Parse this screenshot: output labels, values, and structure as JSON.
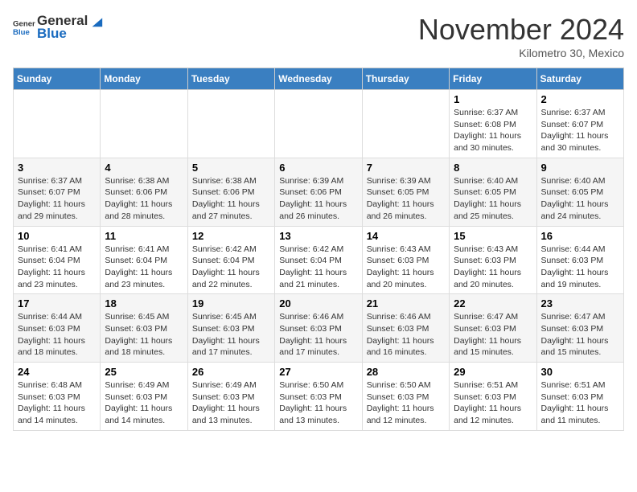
{
  "header": {
    "logo_general": "General",
    "logo_blue": "Blue",
    "month_title": "November 2024",
    "location": "Kilometro 30, Mexico"
  },
  "weekdays": [
    "Sunday",
    "Monday",
    "Tuesday",
    "Wednesday",
    "Thursday",
    "Friday",
    "Saturday"
  ],
  "weeks": [
    [
      {
        "day": "",
        "info": ""
      },
      {
        "day": "",
        "info": ""
      },
      {
        "day": "",
        "info": ""
      },
      {
        "day": "",
        "info": ""
      },
      {
        "day": "",
        "info": ""
      },
      {
        "day": "1",
        "info": "Sunrise: 6:37 AM\nSunset: 6:08 PM\nDaylight: 11 hours and 30 minutes."
      },
      {
        "day": "2",
        "info": "Sunrise: 6:37 AM\nSunset: 6:07 PM\nDaylight: 11 hours and 30 minutes."
      }
    ],
    [
      {
        "day": "3",
        "info": "Sunrise: 6:37 AM\nSunset: 6:07 PM\nDaylight: 11 hours and 29 minutes."
      },
      {
        "day": "4",
        "info": "Sunrise: 6:38 AM\nSunset: 6:06 PM\nDaylight: 11 hours and 28 minutes."
      },
      {
        "day": "5",
        "info": "Sunrise: 6:38 AM\nSunset: 6:06 PM\nDaylight: 11 hours and 27 minutes."
      },
      {
        "day": "6",
        "info": "Sunrise: 6:39 AM\nSunset: 6:06 PM\nDaylight: 11 hours and 26 minutes."
      },
      {
        "day": "7",
        "info": "Sunrise: 6:39 AM\nSunset: 6:05 PM\nDaylight: 11 hours and 26 minutes."
      },
      {
        "day": "8",
        "info": "Sunrise: 6:40 AM\nSunset: 6:05 PM\nDaylight: 11 hours and 25 minutes."
      },
      {
        "day": "9",
        "info": "Sunrise: 6:40 AM\nSunset: 6:05 PM\nDaylight: 11 hours and 24 minutes."
      }
    ],
    [
      {
        "day": "10",
        "info": "Sunrise: 6:41 AM\nSunset: 6:04 PM\nDaylight: 11 hours and 23 minutes."
      },
      {
        "day": "11",
        "info": "Sunrise: 6:41 AM\nSunset: 6:04 PM\nDaylight: 11 hours and 23 minutes."
      },
      {
        "day": "12",
        "info": "Sunrise: 6:42 AM\nSunset: 6:04 PM\nDaylight: 11 hours and 22 minutes."
      },
      {
        "day": "13",
        "info": "Sunrise: 6:42 AM\nSunset: 6:04 PM\nDaylight: 11 hours and 21 minutes."
      },
      {
        "day": "14",
        "info": "Sunrise: 6:43 AM\nSunset: 6:03 PM\nDaylight: 11 hours and 20 minutes."
      },
      {
        "day": "15",
        "info": "Sunrise: 6:43 AM\nSunset: 6:03 PM\nDaylight: 11 hours and 20 minutes."
      },
      {
        "day": "16",
        "info": "Sunrise: 6:44 AM\nSunset: 6:03 PM\nDaylight: 11 hours and 19 minutes."
      }
    ],
    [
      {
        "day": "17",
        "info": "Sunrise: 6:44 AM\nSunset: 6:03 PM\nDaylight: 11 hours and 18 minutes."
      },
      {
        "day": "18",
        "info": "Sunrise: 6:45 AM\nSunset: 6:03 PM\nDaylight: 11 hours and 18 minutes."
      },
      {
        "day": "19",
        "info": "Sunrise: 6:45 AM\nSunset: 6:03 PM\nDaylight: 11 hours and 17 minutes."
      },
      {
        "day": "20",
        "info": "Sunrise: 6:46 AM\nSunset: 6:03 PM\nDaylight: 11 hours and 17 minutes."
      },
      {
        "day": "21",
        "info": "Sunrise: 6:46 AM\nSunset: 6:03 PM\nDaylight: 11 hours and 16 minutes."
      },
      {
        "day": "22",
        "info": "Sunrise: 6:47 AM\nSunset: 6:03 PM\nDaylight: 11 hours and 15 minutes."
      },
      {
        "day": "23",
        "info": "Sunrise: 6:47 AM\nSunset: 6:03 PM\nDaylight: 11 hours and 15 minutes."
      }
    ],
    [
      {
        "day": "24",
        "info": "Sunrise: 6:48 AM\nSunset: 6:03 PM\nDaylight: 11 hours and 14 minutes."
      },
      {
        "day": "25",
        "info": "Sunrise: 6:49 AM\nSunset: 6:03 PM\nDaylight: 11 hours and 14 minutes."
      },
      {
        "day": "26",
        "info": "Sunrise: 6:49 AM\nSunset: 6:03 PM\nDaylight: 11 hours and 13 minutes."
      },
      {
        "day": "27",
        "info": "Sunrise: 6:50 AM\nSunset: 6:03 PM\nDaylight: 11 hours and 13 minutes."
      },
      {
        "day": "28",
        "info": "Sunrise: 6:50 AM\nSunset: 6:03 PM\nDaylight: 11 hours and 12 minutes."
      },
      {
        "day": "29",
        "info": "Sunrise: 6:51 AM\nSunset: 6:03 PM\nDaylight: 11 hours and 12 minutes."
      },
      {
        "day": "30",
        "info": "Sunrise: 6:51 AM\nSunset: 6:03 PM\nDaylight: 11 hours and 11 minutes."
      }
    ]
  ]
}
